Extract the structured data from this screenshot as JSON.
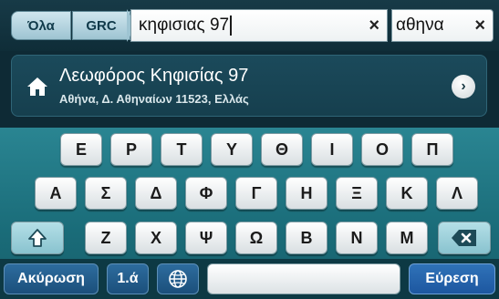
{
  "search_bar": {
    "filter_all": "Όλα",
    "filter_grc": "GRC",
    "query": "κηφισιας 97",
    "city": "αθηνα",
    "clear_symbol": "×"
  },
  "result": {
    "title": "Λεωφόρος Κηφισίας 97",
    "subtitle": "Αθήνα, Δ. Αθηναίων 11523, Ελλάς",
    "icon": "home-icon",
    "go_symbol": "›"
  },
  "keyboard": {
    "row1": [
      "Ε",
      "Ρ",
      "Τ",
      "Υ",
      "Θ",
      "Ι",
      "Ο",
      "Π"
    ],
    "row2": [
      "Α",
      "Σ",
      "Δ",
      "Φ",
      "Γ",
      "Η",
      "Ξ",
      "Κ",
      "Λ"
    ],
    "row3": [
      "Ζ",
      "Χ",
      "Ψ",
      "Ω",
      "Β",
      "Ν",
      "Μ"
    ],
    "shift_icon": "shift-arrow-icon",
    "backspace_icon": "backspace-icon",
    "cancel_label": "Ακύρωση",
    "numeric_label": "1.ά",
    "globe_icon": "globe-icon",
    "search_label": "Εύρεση"
  }
}
